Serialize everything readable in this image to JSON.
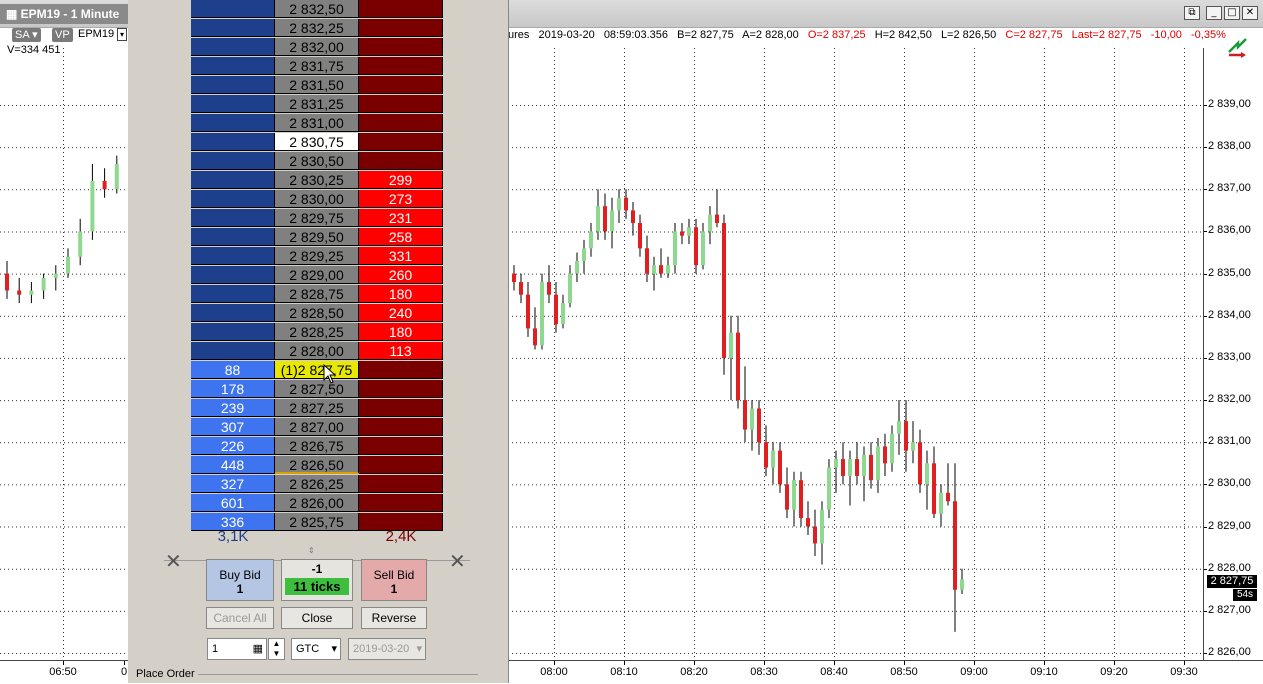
{
  "window": {
    "title": "EPM19 - 1 Minute",
    "buttons": [
      "⧉",
      "_",
      "□",
      "✕"
    ]
  },
  "toolbar": {
    "sa_label": "SA",
    "vp_label": "VP",
    "symbol": "EPM19",
    "volume": "V=334 451"
  },
  "info_line": {
    "instrument": "ures",
    "date": "2019-03-20",
    "time": "08:59:03.356",
    "bid": "B=2 827,75",
    "ask": "A=2 828,00",
    "open": "O=2 837,25",
    "high": "H=2 842,50",
    "low": "L=2 826,50",
    "close": "C=2 827,75",
    "last": "Last=2 827,75",
    "change": "-10,00",
    "change_pct": "-0,35%"
  },
  "colors": {
    "up_candle": "#8fd88f",
    "down_candle": "#e02020",
    "bid_dark": "#1e3f8c",
    "bid_light": "#3e74f0",
    "ask_dark": "#7a0000",
    "ask_light": "#ff0000",
    "highlight": "#e8e800"
  },
  "price_axis": [
    "2 839,00",
    "2 838,00",
    "2 837,00",
    "2 836,00",
    "2 835,00",
    "2 834,00",
    "2 833,00",
    "2 832,00",
    "2 831,00",
    "2 830,00",
    "2 829,00",
    "2 828,00",
    "2 827,00",
    "2 826,00"
  ],
  "last_price_tag": "2 827,75",
  "countdown": "54s",
  "time_axis": [
    "06:50",
    "0",
    "08:00",
    "08:10",
    "08:20",
    "08:30",
    "08:40",
    "08:50",
    "09:00",
    "09:10",
    "09:20",
    "09:30"
  ],
  "ladder": {
    "rows": [
      {
        "bid": "",
        "price": "2 832,50",
        "ask": ""
      },
      {
        "bid": "",
        "price": "2 832,25",
        "ask": ""
      },
      {
        "bid": "",
        "price": "2 832,00",
        "ask": ""
      },
      {
        "bid": "",
        "price": "2 831,75",
        "ask": ""
      },
      {
        "bid": "",
        "price": "2 831,50",
        "ask": ""
      },
      {
        "bid": "",
        "price": "2 831,25",
        "ask": ""
      },
      {
        "bid": "",
        "price": "2 831,00",
        "ask": ""
      },
      {
        "bid": "",
        "price": "2 830,75",
        "ask": "",
        "current": true
      },
      {
        "bid": "",
        "price": "2 830,50",
        "ask": ""
      },
      {
        "bid": "",
        "price": "2 830,25",
        "ask": "299"
      },
      {
        "bid": "",
        "price": "2 830,00",
        "ask": "273"
      },
      {
        "bid": "",
        "price": "2 829,75",
        "ask": "231"
      },
      {
        "bid": "",
        "price": "2 829,50",
        "ask": "258"
      },
      {
        "bid": "",
        "price": "2 829,25",
        "ask": "331"
      },
      {
        "bid": "",
        "price": "2 829,00",
        "ask": "260"
      },
      {
        "bid": "",
        "price": "2 828,75",
        "ask": "180"
      },
      {
        "bid": "",
        "price": "2 828,50",
        "ask": "240"
      },
      {
        "bid": "",
        "price": "2 828,25",
        "ask": "180"
      },
      {
        "bid": "",
        "price": "2 828,00",
        "ask": "113"
      },
      {
        "bid": "88",
        "price": "(1)2 827,75",
        "ask": "",
        "last": true
      },
      {
        "bid": "178",
        "price": "2 827,50",
        "ask": ""
      },
      {
        "bid": "239",
        "price": "2 827,25",
        "ask": ""
      },
      {
        "bid": "307",
        "price": "2 827,00",
        "ask": ""
      },
      {
        "bid": "226",
        "price": "2 826,75",
        "ask": ""
      },
      {
        "bid": "448",
        "price": "2 826,50",
        "ask": ""
      },
      {
        "bid": "327",
        "price": "2 826,25",
        "ask": ""
      },
      {
        "bid": "601",
        "price": "2 826,00",
        "ask": ""
      },
      {
        "bid": "336",
        "price": "2 825,75",
        "ask": ""
      }
    ],
    "bid_total": "3,1K",
    "ask_total": "2,4K"
  },
  "order": {
    "buy_label": "Buy Bid",
    "buy_qty": "1",
    "position": "-1",
    "ticks": "11 ticks",
    "sell_label": "Sell Bid",
    "sell_qty": "1",
    "cancel_all": "Cancel All",
    "close": "Close",
    "reverse": "Reverse",
    "quantity": "1",
    "tif": "GTC",
    "date": "2019-03-20",
    "place_order": "Place Order"
  },
  "chart_data": {
    "type": "candlestick",
    "ylim": [
      2826.0,
      2839.5
    ],
    "candles_visible_right": [
      {
        "t": "07:53",
        "o": 2835.0,
        "h": 2835.2,
        "l": 2834.6,
        "c": 2834.8
      },
      {
        "t": "07:54",
        "o": 2834.8,
        "h": 2835.0,
        "l": 2834.3,
        "c": 2834.5
      },
      {
        "t": "07:55",
        "o": 2834.5,
        "h": 2834.8,
        "l": 2833.5,
        "c": 2833.7
      },
      {
        "t": "07:56",
        "o": 2833.7,
        "h": 2834.2,
        "l": 2833.2,
        "c": 2833.3
      },
      {
        "t": "07:57",
        "o": 2833.3,
        "h": 2835.0,
        "l": 2833.2,
        "c": 2834.8
      },
      {
        "t": "07:58",
        "o": 2834.8,
        "h": 2835.2,
        "l": 2834.3,
        "c": 2834.5
      },
      {
        "t": "07:59",
        "o": 2834.5,
        "h": 2834.8,
        "l": 2833.6,
        "c": 2833.8
      },
      {
        "t": "08:00",
        "o": 2833.8,
        "h": 2834.5,
        "l": 2833.7,
        "c": 2834.3
      },
      {
        "t": "08:01",
        "o": 2834.3,
        "h": 2835.2,
        "l": 2834.2,
        "c": 2835.0
      },
      {
        "t": "08:02",
        "o": 2835.0,
        "h": 2835.5,
        "l": 2834.8,
        "c": 2835.3
      },
      {
        "t": "08:03",
        "o": 2835.3,
        "h": 2835.8,
        "l": 2835.0,
        "c": 2835.6
      },
      {
        "t": "08:04",
        "o": 2835.6,
        "h": 2836.2,
        "l": 2835.4,
        "c": 2836.0
      },
      {
        "t": "08:05",
        "o": 2836.0,
        "h": 2837.0,
        "l": 2835.8,
        "c": 2836.6
      },
      {
        "t": "08:06",
        "o": 2836.6,
        "h": 2836.9,
        "l": 2835.8,
        "c": 2836.0
      },
      {
        "t": "08:07",
        "o": 2836.0,
        "h": 2836.8,
        "l": 2835.6,
        "c": 2836.5
      },
      {
        "t": "08:08",
        "o": 2836.5,
        "h": 2837.0,
        "l": 2836.2,
        "c": 2836.8
      },
      {
        "t": "08:09",
        "o": 2836.8,
        "h": 2837.0,
        "l": 2836.3,
        "c": 2836.5
      },
      {
        "t": "08:10",
        "o": 2836.5,
        "h": 2836.7,
        "l": 2835.9,
        "c": 2836.2
      },
      {
        "t": "08:11",
        "o": 2836.2,
        "h": 2836.4,
        "l": 2835.4,
        "c": 2835.6
      },
      {
        "t": "08:12",
        "o": 2835.6,
        "h": 2835.9,
        "l": 2834.8,
        "c": 2835.0
      },
      {
        "t": "08:13",
        "o": 2835.0,
        "h": 2835.4,
        "l": 2834.6,
        "c": 2835.2
      },
      {
        "t": "08:14",
        "o": 2835.2,
        "h": 2835.6,
        "l": 2834.9,
        "c": 2835.0
      },
      {
        "t": "08:15",
        "o": 2835.0,
        "h": 2835.4,
        "l": 2834.9,
        "c": 2835.2
      },
      {
        "t": "08:16",
        "o": 2835.2,
        "h": 2836.2,
        "l": 2835.0,
        "c": 2836.0
      },
      {
        "t": "08:17",
        "o": 2836.0,
        "h": 2836.2,
        "l": 2835.7,
        "c": 2835.9
      },
      {
        "t": "08:18",
        "o": 2835.9,
        "h": 2836.3,
        "l": 2835.7,
        "c": 2836.1
      },
      {
        "t": "08:19",
        "o": 2836.1,
        "h": 2836.3,
        "l": 2835.0,
        "c": 2835.2
      },
      {
        "t": "08:20",
        "o": 2835.2,
        "h": 2836.2,
        "l": 2835.1,
        "c": 2836.0
      },
      {
        "t": "08:21",
        "o": 2836.0,
        "h": 2836.6,
        "l": 2835.7,
        "c": 2836.4
      },
      {
        "t": "08:22",
        "o": 2836.4,
        "h": 2837.0,
        "l": 2836.1,
        "c": 2836.2
      },
      {
        "t": "08:23",
        "o": 2836.2,
        "h": 2836.4,
        "l": 2832.6,
        "c": 2833.0
      },
      {
        "t": "08:24",
        "o": 2833.0,
        "h": 2834.0,
        "l": 2832.0,
        "c": 2833.6
      },
      {
        "t": "08:25",
        "o": 2833.6,
        "h": 2834.0,
        "l": 2831.8,
        "c": 2832.0
      },
      {
        "t": "08:26",
        "o": 2832.0,
        "h": 2832.8,
        "l": 2831.0,
        "c": 2831.3
      },
      {
        "t": "08:27",
        "o": 2831.3,
        "h": 2832.0,
        "l": 2830.8,
        "c": 2831.8
      },
      {
        "t": "08:28",
        "o": 2831.8,
        "h": 2832.0,
        "l": 2830.7,
        "c": 2831.0
      },
      {
        "t": "08:29",
        "o": 2831.0,
        "h": 2831.4,
        "l": 2830.2,
        "c": 2830.4
      },
      {
        "t": "08:30",
        "o": 2830.4,
        "h": 2831.0,
        "l": 2830.0,
        "c": 2830.8
      },
      {
        "t": "08:31",
        "o": 2830.8,
        "h": 2831.0,
        "l": 2829.8,
        "c": 2830.0
      },
      {
        "t": "08:32",
        "o": 2830.0,
        "h": 2830.4,
        "l": 2829.2,
        "c": 2829.4
      },
      {
        "t": "08:33",
        "o": 2829.4,
        "h": 2830.3,
        "l": 2829.0,
        "c": 2830.1
      },
      {
        "t": "08:34",
        "o": 2830.1,
        "h": 2830.3,
        "l": 2829.0,
        "c": 2829.2
      },
      {
        "t": "08:35",
        "o": 2829.2,
        "h": 2829.6,
        "l": 2828.8,
        "c": 2829.0
      },
      {
        "t": "08:36",
        "o": 2829.0,
        "h": 2829.4,
        "l": 2828.3,
        "c": 2828.6
      },
      {
        "t": "08:37",
        "o": 2828.6,
        "h": 2829.6,
        "l": 2828.1,
        "c": 2829.4
      },
      {
        "t": "08:38",
        "o": 2829.4,
        "h": 2830.6,
        "l": 2829.2,
        "c": 2830.4
      },
      {
        "t": "08:39",
        "o": 2830.4,
        "h": 2830.8,
        "l": 2829.8,
        "c": 2830.6
      },
      {
        "t": "08:40",
        "o": 2830.6,
        "h": 2831.0,
        "l": 2830.0,
        "c": 2830.2
      },
      {
        "t": "08:41",
        "o": 2830.2,
        "h": 2830.8,
        "l": 2829.5,
        "c": 2830.6
      },
      {
        "t": "08:42",
        "o": 2830.6,
        "h": 2831.0,
        "l": 2830.0,
        "c": 2830.2
      },
      {
        "t": "08:43",
        "o": 2830.2,
        "h": 2830.9,
        "l": 2829.6,
        "c": 2830.7
      },
      {
        "t": "08:44",
        "o": 2830.7,
        "h": 2831.0,
        "l": 2829.9,
        "c": 2830.1
      },
      {
        "t": "08:45",
        "o": 2830.1,
        "h": 2831.1,
        "l": 2829.8,
        "c": 2830.9
      },
      {
        "t": "08:46",
        "o": 2830.9,
        "h": 2831.2,
        "l": 2830.2,
        "c": 2830.5
      },
      {
        "t": "08:47",
        "o": 2830.5,
        "h": 2831.4,
        "l": 2830.3,
        "c": 2831.2
      },
      {
        "t": "08:48",
        "o": 2831.2,
        "h": 2832.0,
        "l": 2830.7,
        "c": 2831.5
      },
      {
        "t": "08:49",
        "o": 2831.5,
        "h": 2832.0,
        "l": 2830.3,
        "c": 2830.8
      },
      {
        "t": "08:50",
        "o": 2830.8,
        "h": 2831.5,
        "l": 2830.5,
        "c": 2831.0
      },
      {
        "t": "08:51",
        "o": 2831.0,
        "h": 2831.3,
        "l": 2829.8,
        "c": 2830.0
      },
      {
        "t": "08:52",
        "o": 2830.0,
        "h": 2830.8,
        "l": 2829.4,
        "c": 2830.5
      },
      {
        "t": "08:53",
        "o": 2830.5,
        "h": 2830.9,
        "l": 2829.2,
        "c": 2829.3
      },
      {
        "t": "08:54",
        "o": 2829.3,
        "h": 2830.0,
        "l": 2829.0,
        "c": 2829.8
      },
      {
        "t": "08:55",
        "o": 2829.8,
        "h": 2830.5,
        "l": 2829.5,
        "c": 2829.6
      },
      {
        "t": "08:56",
        "o": 2829.6,
        "h": 2830.5,
        "l": 2826.5,
        "c": 2827.5
      },
      {
        "t": "08:57",
        "o": 2827.5,
        "h": 2828.0,
        "l": 2827.4,
        "c": 2827.75
      }
    ],
    "candles_visible_left": [
      {
        "t": "06:48",
        "o": 2835.0,
        "h": 2835.3,
        "l": 2834.4,
        "c": 2834.6
      },
      {
        "t": "06:49",
        "o": 2834.6,
        "h": 2834.9,
        "l": 2834.3,
        "c": 2834.5
      },
      {
        "t": "06:50",
        "o": 2834.5,
        "h": 2834.8,
        "l": 2834.3,
        "c": 2834.6
      },
      {
        "t": "06:51",
        "o": 2834.6,
        "h": 2835.0,
        "l": 2834.4,
        "c": 2834.9
      },
      {
        "t": "06:52",
        "o": 2834.9,
        "h": 2835.2,
        "l": 2834.6,
        "c": 2835.0
      },
      {
        "t": "06:53",
        "o": 2835.0,
        "h": 2835.6,
        "l": 2834.9,
        "c": 2835.4
      },
      {
        "t": "06:54",
        "o": 2835.4,
        "h": 2836.3,
        "l": 2835.2,
        "c": 2836.0
      },
      {
        "t": "06:55",
        "o": 2836.0,
        "h": 2837.6,
        "l": 2835.8,
        "c": 2837.2
      },
      {
        "t": "06:56",
        "o": 2837.2,
        "h": 2837.5,
        "l": 2836.8,
        "c": 2837.0
      },
      {
        "t": "06:57",
        "o": 2837.0,
        "h": 2837.8,
        "l": 2836.9,
        "c": 2837.6
      }
    ]
  }
}
